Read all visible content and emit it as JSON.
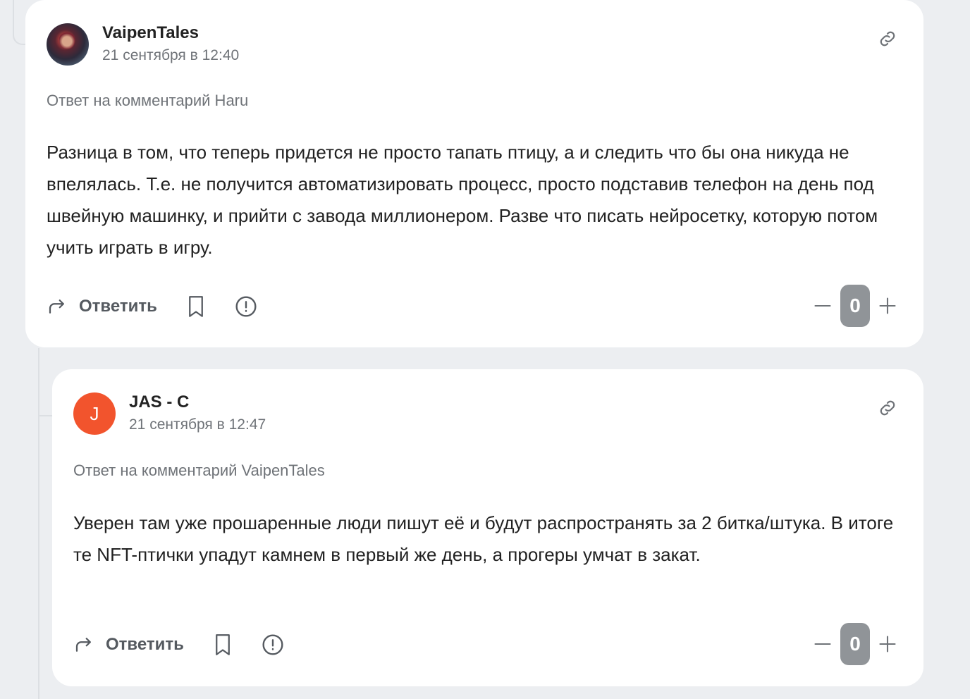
{
  "comments": [
    {
      "author": "VaipenTales",
      "date": "21 сентября в 12:40",
      "avatar_letter": "",
      "reply_to": "Ответ на комментарий Haru",
      "text": "Разница в том, что теперь придется не просто тапать птицу, а и следить что бы она никуда не впелялась. Т.е. не получится автоматизировать процесс, просто подставив телефон на день под швейную машинку, и прийти с завода миллионером. Разве что писать нейросетку, которую потом учить играть в игру.",
      "reply_label": "Ответить",
      "score": "0"
    },
    {
      "author": "JAS - C",
      "date": "21 сентября в 12:47",
      "avatar_letter": "J",
      "avatar_color": "#f2542d",
      "reply_to": "Ответ на комментарий VaipenTales",
      "text": "Уверен там уже прошаренные люди пишут её и будут распространять за 2 битка/штука. В итоге те NFT-птички упадут камнем в первый же день, а прогеры умчат в закат.",
      "reply_label": "Ответить",
      "score": "0"
    }
  ],
  "icons": {
    "link": "link-icon",
    "reply": "reply-arrow-icon",
    "bookmark": "bookmark-icon",
    "report": "exclamation-circle-icon",
    "downvote": "minus-icon",
    "upvote": "plus-icon"
  }
}
